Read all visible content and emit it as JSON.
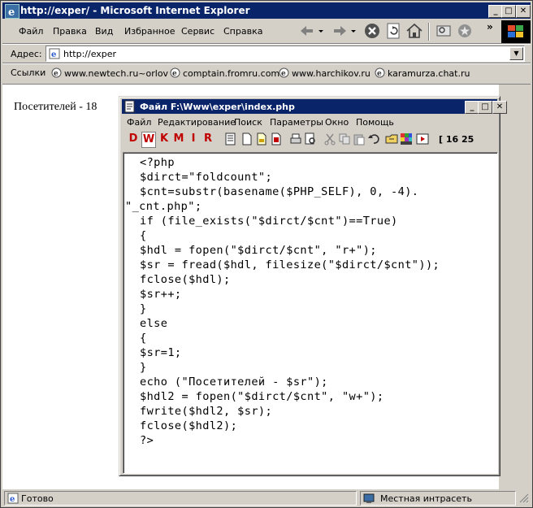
{
  "window": {
    "title": "http://exper/ - Microsoft Internet Explorer",
    "controls": {
      "minimize": "_",
      "maximize": "□",
      "close": "✕"
    }
  },
  "menu": [
    "Файл",
    "Правка",
    "Вид",
    "Избранное",
    "Сервис",
    "Справка"
  ],
  "address": {
    "label": "Адрес:",
    "value": "http://exper"
  },
  "links": {
    "label": "Ссылки",
    "items": [
      "www.newtech.ru~orlov",
      "comptain.fromru.com",
      "www.harchikov.ru",
      "karamurza.chat.ru"
    ]
  },
  "page": {
    "visitors_text": "Посетителей - 18"
  },
  "editor": {
    "title": "Файл F:\\Www\\exper\\index.php",
    "menu": [
      "Файл",
      "Редактирование",
      "Поиск",
      "Параметры",
      "Окно",
      "Помощь"
    ],
    "tool_letters": [
      "D",
      "W",
      "K",
      "M",
      "I",
      "R"
    ],
    "cursor_pos": "[ 16  25",
    "code": [
      "<?php",
      "$dirct=\"foldcount\";",
      "$cnt=substr(basename($PHP_SELF), 0, -4).",
      "\"_cnt.php\";",
      "if (file_exists(\"$dirct/$cnt\")==True)",
      "{",
      "$hdl = fopen(\"$dirct/$cnt\", \"r+\");",
      "$sr = fread($hdl, filesize(\"$dirct/$cnt\"));",
      "fclose($hdl);",
      "$sr++;",
      "}",
      "else",
      "{",
      "$sr=1;",
      "}",
      "echo (\"Посетителей - $sr\");",
      "$hdl2 = fopen(\"$dirct/$cnt\", \"w+\");",
      "fwrite($hdl2, $sr);",
      "fclose($hdl2);",
      "?>"
    ]
  },
  "status": {
    "left": "Готово",
    "zone": "Местная интрасеть"
  }
}
